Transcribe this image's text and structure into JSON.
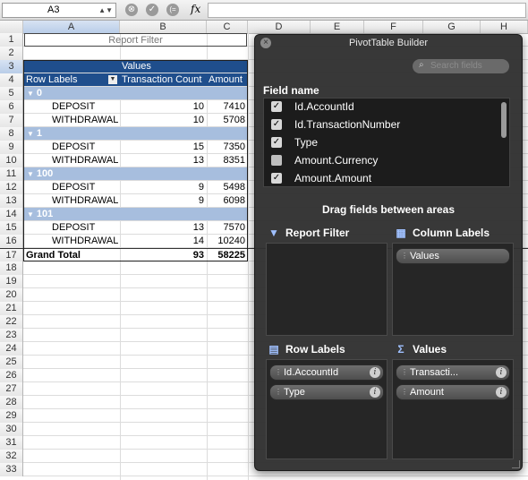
{
  "namebox": {
    "value": "A3"
  },
  "formula": {
    "fx_label": "fx",
    "cancel_glyph": "⊗",
    "enter_glyph": "✓",
    "bracket_glyph": "(="
  },
  "columns": [
    "A",
    "B",
    "C",
    "D",
    "E",
    "F",
    "G",
    "H"
  ],
  "rows": [
    "1",
    "2",
    "3",
    "4",
    "5",
    "6",
    "7",
    "8",
    "9",
    "10",
    "11",
    "12",
    "13",
    "14",
    "15",
    "16",
    "17",
    "18",
    "19",
    "20",
    "21",
    "22",
    "23",
    "24",
    "25",
    "26",
    "27",
    "28",
    "29",
    "30",
    "31",
    "32",
    "33"
  ],
  "pivot": {
    "report_filter_label": "Report Filter",
    "values_header": "Values",
    "row_labels_header": "Row Labels",
    "col_count_header": "Transaction Count",
    "col_amount_header": "Amount",
    "groups": [
      {
        "name": "0",
        "items": [
          {
            "label": "DEPOSIT",
            "count": "10",
            "amount": "7410"
          },
          {
            "label": "WITHDRAWAL",
            "count": "10",
            "amount": "5708"
          }
        ]
      },
      {
        "name": "1",
        "items": [
          {
            "label": "DEPOSIT",
            "count": "15",
            "amount": "7350"
          },
          {
            "label": "WITHDRAWAL",
            "count": "13",
            "amount": "8351"
          }
        ]
      },
      {
        "name": "100",
        "items": [
          {
            "label": "DEPOSIT",
            "count": "9",
            "amount": "5498"
          },
          {
            "label": "WITHDRAWAL",
            "count": "9",
            "amount": "6098"
          }
        ]
      },
      {
        "name": "101",
        "items": [
          {
            "label": "DEPOSIT",
            "count": "13",
            "amount": "7570"
          },
          {
            "label": "WITHDRAWAL",
            "count": "14",
            "amount": "10240"
          }
        ]
      }
    ],
    "grand_total_label": "Grand Total",
    "grand_total_count": "93",
    "grand_total_amount": "58225"
  },
  "builder": {
    "title": "PivotTable Builder",
    "search_placeholder": "Search fields",
    "field_name_label": "Field name",
    "fields": [
      {
        "label": "Id.AccountId",
        "checked": true
      },
      {
        "label": "Id.TransactionNumber",
        "checked": true
      },
      {
        "label": "Type",
        "checked": true
      },
      {
        "label": "Amount.Currency",
        "checked": false
      },
      {
        "label": "Amount.Amount",
        "checked": true
      }
    ],
    "drag_hint": "Drag fields between areas",
    "report_filter_title": "Report Filter",
    "column_labels_title": "Column Labels",
    "column_labels_items": [
      "Values"
    ],
    "row_labels_title": "Row Labels",
    "row_labels_items": [
      "Id.AccountId",
      "Type"
    ],
    "values_title": "Values",
    "values_items": [
      "Transacti...",
      "Amount"
    ]
  },
  "colors": {
    "header_band": "#1f4e8c",
    "group_band": "#a7bede",
    "builder_bg": "#303030"
  }
}
